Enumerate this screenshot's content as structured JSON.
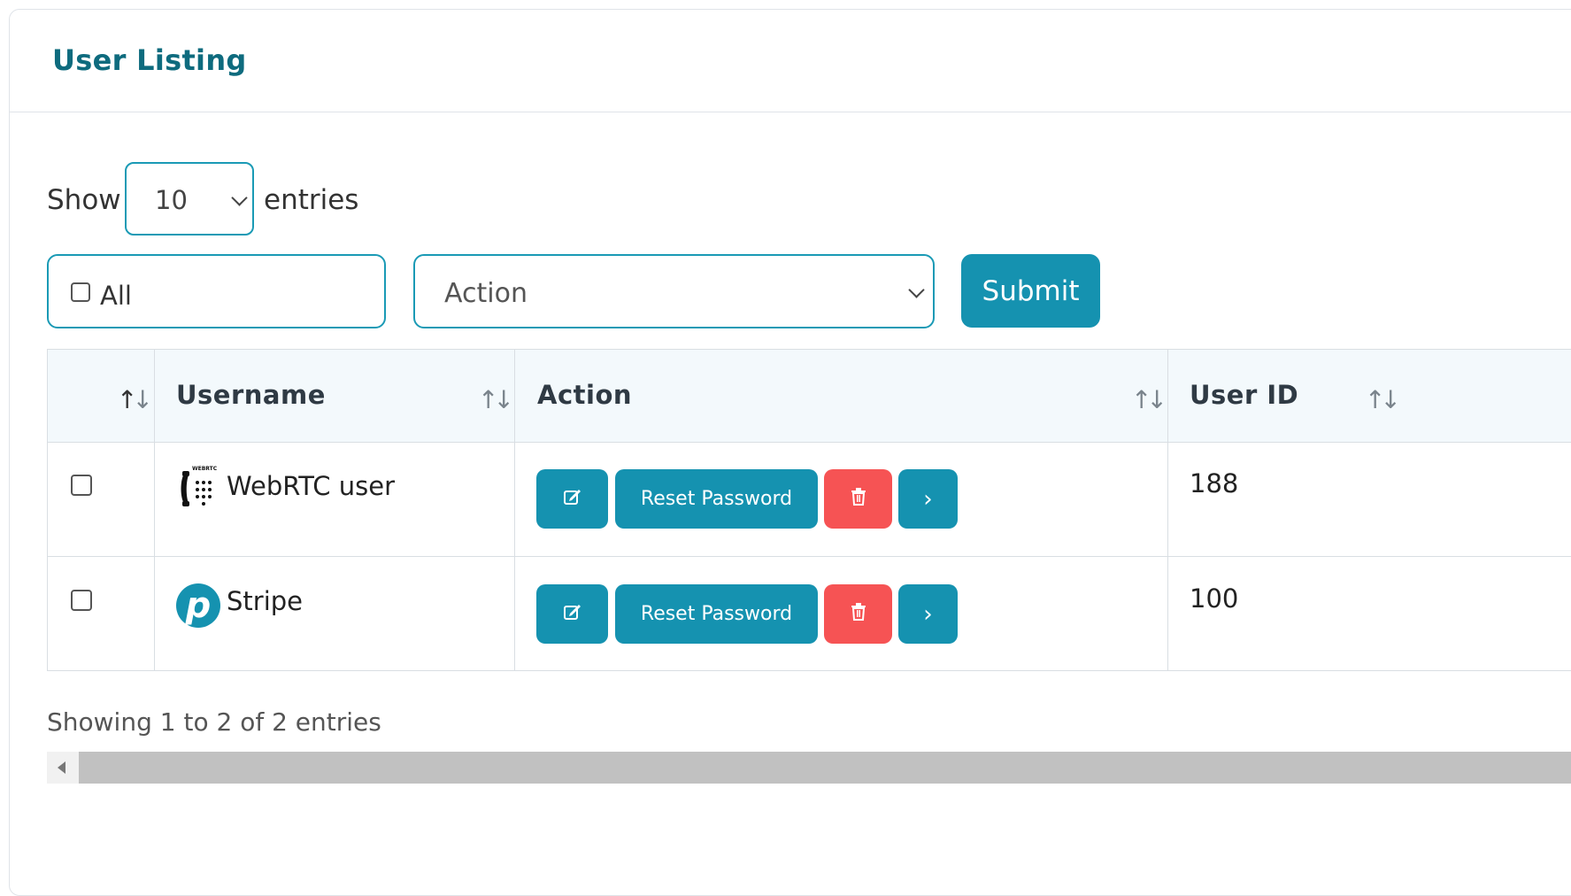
{
  "page": {
    "title": "User Listing"
  },
  "length": {
    "show_label": "Show",
    "value": "10",
    "entries_label": "entries"
  },
  "bulk": {
    "all_label": "All",
    "action_selected": "Action",
    "submit_label": "Submit"
  },
  "table": {
    "headers": {
      "select": "",
      "username": "Username",
      "action": "Action",
      "user_id": "User ID"
    },
    "sort_icon": "↑↓",
    "rows": [
      {
        "username": "WebRTC user",
        "avatar": "phone-dialpad-icon",
        "avatar_caption": "WEBRTC",
        "reset_label": "Reset Password",
        "user_id": "188"
      },
      {
        "username": "Stripe",
        "avatar": "p-logo-icon",
        "avatar_letter": "p",
        "reset_label": "Reset Password",
        "user_id": "100"
      }
    ]
  },
  "footer": {
    "info": "Showing 1 to 2 of 2 entries"
  },
  "colors": {
    "accent": "#1592b0",
    "title": "#0e6b7e",
    "danger": "#f65354",
    "header_bg": "#f3f9fc"
  }
}
